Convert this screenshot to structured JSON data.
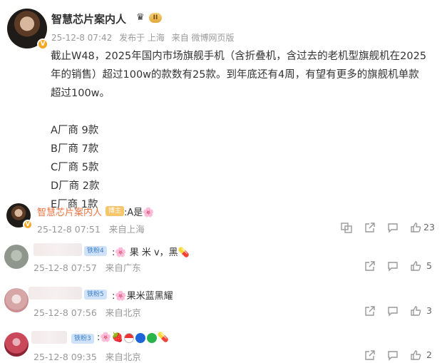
{
  "post": {
    "author": "智慧芯片案内人",
    "level_badge": "II",
    "time": "25-12-8 07:42",
    "published_from": "发布于 上海",
    "source": "来自 微博网页版",
    "body_lines": [
      "截止W48，2025年国内市场旗舰手机（含折叠机，含过去的老机型旗舰机在2025",
      "年的销售）超过100w的款数有25款。到年底还有4周，有望有更多的旗舰机单款",
      "超过100w。"
    ],
    "vendor_lines": [
      "A厂商  9款",
      "B厂商  7款",
      "C厂商  5款",
      "D厂商  2款",
      "E厂商  1款"
    ]
  },
  "comments": [
    {
      "name": "智慧芯片案内人",
      "tag": "博主",
      "text": ":A是",
      "emoji": "flower",
      "time": "25-12-8 07:51",
      "location": "来自上海",
      "likes": "23",
      "avatar_color": "#2a211c"
    },
    {
      "name": "",
      "tag": "铁粉4",
      "text": ":",
      "text2": "果 米 v，黑",
      "emoji": "flower",
      "time": "25-12-8 07:57",
      "location": "来自广东",
      "likes": "5",
      "avatar_color": "#9aa39a"
    },
    {
      "name": "",
      "tag": "铁粉5",
      "text": ":",
      "text2": "果米蓝黑耀",
      "emoji": "flower",
      "time": "25-12-8 07:56",
      "location": "来自北京",
      "likes": "3",
      "avatar_color": "#d7a7a8"
    },
    {
      "name": "",
      "tag": "铁粉3",
      "text": ":",
      "emoji": "flower",
      "time": "25-12-8 09:35",
      "location": "来自北京",
      "likes": "2",
      "avatar_color": "#c9485a"
    }
  ],
  "icons": {
    "share": "share-icon",
    "comment": "comment-icon",
    "like": "like-icon",
    "translate": "translate-icon"
  },
  "colors": {
    "author_name": "#eb7340",
    "owner_tag": "#f7c66b",
    "fan_tag": "#cfe2f7"
  }
}
